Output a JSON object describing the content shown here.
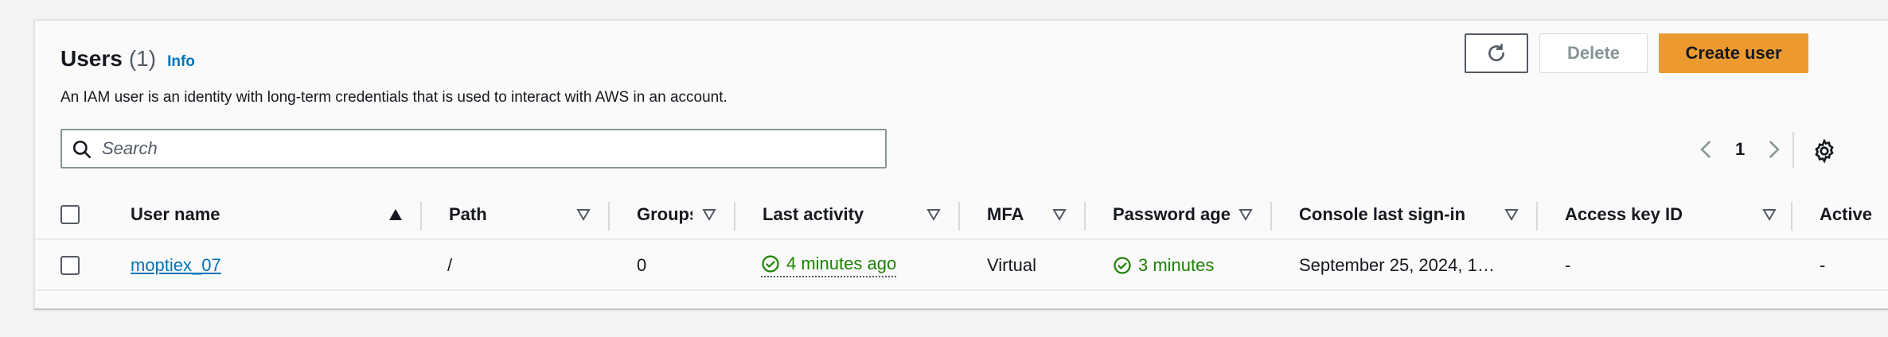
{
  "header": {
    "title": "Users",
    "count": "(1)",
    "info_label": "Info",
    "description": "An IAM user is an identity with long-term credentials that is used to interact with AWS in an account."
  },
  "actions": {
    "refresh_icon": "refresh-icon",
    "delete_label": "Delete",
    "create_label": "Create user",
    "create_color": "#ec9a30"
  },
  "search": {
    "placeholder": "Search",
    "value": ""
  },
  "pagination": {
    "current_page": "1"
  },
  "table": {
    "columns": [
      {
        "label": "User name",
        "sort": "asc"
      },
      {
        "label": "Path",
        "sort": "none"
      },
      {
        "label": "Groups",
        "sort": "none"
      },
      {
        "label": "Last activity",
        "sort": "none"
      },
      {
        "label": "MFA",
        "sort": "none"
      },
      {
        "label": "Password age",
        "sort": "none"
      },
      {
        "label": "Console last sign-in",
        "sort": "none"
      },
      {
        "label": "Access key ID",
        "sort": "none"
      },
      {
        "label": "Active",
        "sort": "none"
      }
    ],
    "rows": [
      {
        "user_name": "moptiex_07",
        "path": "/",
        "groups": "0",
        "last_activity": "4 minutes ago",
        "mfa": "Virtual",
        "password_age": "3 minutes",
        "console_last_sign_in": "September 25, 2024, 1…",
        "access_key_id": "-",
        "active": "-"
      }
    ]
  },
  "colors": {
    "link": "#0073bb",
    "success": "#1d8102"
  }
}
